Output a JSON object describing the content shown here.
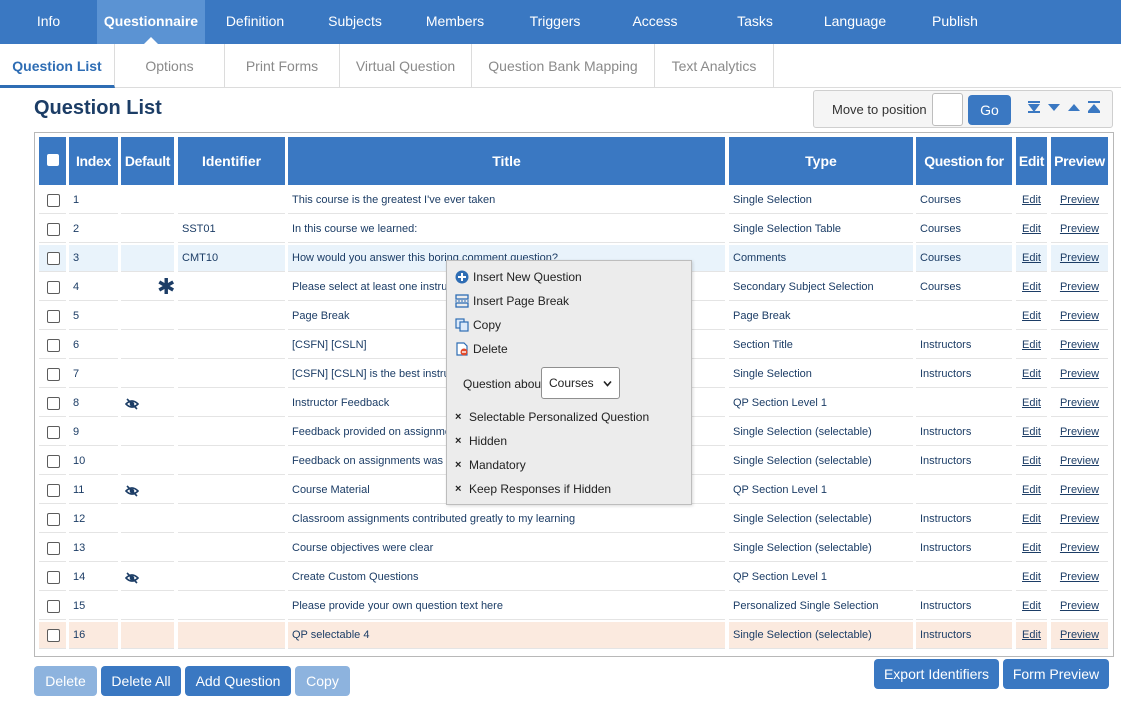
{
  "top_nav": {
    "tabs": [
      "Info",
      "Questionnaire",
      "Definition",
      "Subjects",
      "Members",
      "Triggers",
      "Access",
      "Tasks",
      "Language",
      "Publish"
    ],
    "active": "Questionnaire"
  },
  "sub_nav": {
    "tabs": [
      "Question List",
      "Options",
      "Print Forms",
      "Virtual Question",
      "Question Bank Mapping",
      "Text Analytics"
    ],
    "active": "Question List"
  },
  "page_title": "Question List",
  "move": {
    "label": "Move to position",
    "value": "",
    "go_label": "Go"
  },
  "table": {
    "headers": {
      "index": "Index",
      "default": "Default",
      "identifier": "Identifier",
      "title": "Title",
      "type": "Type",
      "question_for": "Question for",
      "edit": "Edit",
      "preview": "Preview"
    },
    "rows": [
      {
        "index": "1",
        "identifier": "",
        "title": "This course is the greatest I've ever taken",
        "type": "Single Selection",
        "question_for": "Courses",
        "edit": "Edit",
        "preview": "Preview"
      },
      {
        "index": "2",
        "identifier": "SST01",
        "title": "In this course we learned:",
        "type": "Single Selection Table",
        "question_for": "Courses",
        "edit": "Edit",
        "preview": "Preview"
      },
      {
        "index": "3",
        "identifier": "CMT10",
        "title": "How would you answer this boring comment question?",
        "type": "Comments",
        "question_for": "Courses",
        "edit": "Edit",
        "preview": "Preview"
      },
      {
        "index": "4",
        "identifier": "",
        "title": "Please select at least one instructor",
        "type": "Secondary Subject Selection",
        "question_for": "Courses",
        "edit": "Edit",
        "preview": "Preview"
      },
      {
        "index": "5",
        "identifier": "",
        "title": "Page Break",
        "type": "Page Break",
        "question_for": "",
        "edit": "Edit",
        "preview": "Preview"
      },
      {
        "index": "6",
        "identifier": "",
        "title": "[CSFN] [CSLN]",
        "type": "Section Title",
        "question_for": "Instructors",
        "edit": "Edit",
        "preview": "Preview"
      },
      {
        "index": "7",
        "identifier": "",
        "title": "[CSFN] [CSLN] is the best instructor",
        "type": "Single Selection",
        "question_for": "Instructors",
        "edit": "Edit",
        "preview": "Preview"
      },
      {
        "index": "8",
        "identifier": "",
        "title": "Instructor Feedback",
        "type": "QP Section Level 1",
        "question_for": "",
        "edit": "Edit",
        "preview": "Preview"
      },
      {
        "index": "9",
        "identifier": "",
        "title": "Feedback provided on assignments was helpful",
        "type": "Single Selection (selectable)",
        "question_for": "Instructors",
        "edit": "Edit",
        "preview": "Preview"
      },
      {
        "index": "10",
        "identifier": "",
        "title": "Feedback on assignments was given promptly",
        "type": "Single Selection (selectable)",
        "question_for": "Instructors",
        "edit": "Edit",
        "preview": "Preview"
      },
      {
        "index": "11",
        "identifier": "",
        "title": "Course Material",
        "type": "QP Section Level 1",
        "question_for": "",
        "edit": "Edit",
        "preview": "Preview"
      },
      {
        "index": "12",
        "identifier": "",
        "title": "Classroom assignments contributed greatly to my learning",
        "type": "Single Selection (selectable)",
        "question_for": "Instructors",
        "edit": "Edit",
        "preview": "Preview"
      },
      {
        "index": "13",
        "identifier": "",
        "title": "Course objectives were clear",
        "type": "Single Selection (selectable)",
        "question_for": "Instructors",
        "edit": "Edit",
        "preview": "Preview"
      },
      {
        "index": "14",
        "identifier": "",
        "title": "Create Custom Questions",
        "type": "QP Section Level 1",
        "question_for": "",
        "edit": "Edit",
        "preview": "Preview"
      },
      {
        "index": "15",
        "identifier": "",
        "title": "Please provide your own question text here",
        "type": "Personalized Single Selection",
        "question_for": "Instructors",
        "edit": "Edit",
        "preview": "Preview"
      },
      {
        "index": "16",
        "identifier": "",
        "title": "QP selectable 4",
        "type": "Single Selection (selectable)",
        "question_for": "Instructors",
        "edit": "Edit",
        "preview": "Preview"
      }
    ]
  },
  "context_menu": {
    "insert_new_question": "Insert New Question",
    "insert_page_break": "Insert Page Break",
    "copy": "Copy",
    "delete": "Delete",
    "question_about_label": "Question about",
    "question_about_value": "Courses",
    "selectable_personalized": "Selectable Personalized Question",
    "hidden": "Hidden",
    "mandatory": "Mandatory",
    "keep_responses": "Keep Responses if Hidden",
    "check_mark": "×"
  },
  "bottom": {
    "delete": "Delete",
    "delete_all": "Delete All",
    "add_question": "Add Question",
    "copy": "Copy",
    "export_identifiers": "Export Identifiers",
    "form_preview": "Form Preview"
  },
  "symbols": {
    "mandatory_star": "✱"
  },
  "colors": {
    "nav_bg": "#3a78c2",
    "nav_active": "#5b93d3",
    "header_bg": "#3a78c2",
    "selected_row": "#e9f3fb",
    "highlight_row": "#fbeadf",
    "disabled_button": "#8db3de"
  }
}
